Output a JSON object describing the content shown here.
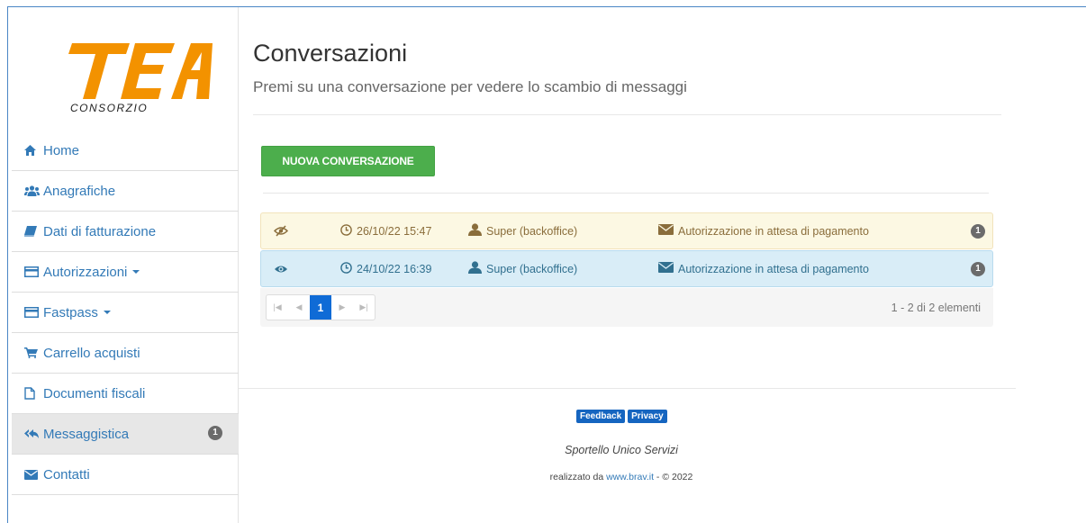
{
  "brand": {
    "logo_text": "TEA",
    "logo_sub": "CONSORZIO"
  },
  "sidebar": {
    "items": [
      {
        "label": "Home",
        "icon": "home-icon"
      },
      {
        "label": "Anagrafiche",
        "icon": "users-icon"
      },
      {
        "label": "Dati di fatturazione",
        "icon": "book-icon"
      },
      {
        "label": "Autorizzazioni",
        "icon": "card-icon",
        "dropdown": true
      },
      {
        "label": "Fastpass",
        "icon": "card-icon",
        "dropdown": true
      },
      {
        "label": "Carrello acquisti",
        "icon": "cart-icon"
      },
      {
        "label": "Documenti fiscali",
        "icon": "file-icon"
      },
      {
        "label": "Messaggistica",
        "icon": "reply-all-icon",
        "badge": "1",
        "active": true
      },
      {
        "label": "Contatti",
        "icon": "envelope-icon"
      }
    ]
  },
  "main": {
    "title": "Conversazioni",
    "subtitle": "Premi su una conversazione per vedere lo scambio di messaggi",
    "new_button": "NUOVA CONVERSAZIONE"
  },
  "conversations": [
    {
      "state": "unread",
      "icon": "eye-slash-icon",
      "date": "26/10/22 15:47",
      "user": "Super (backoffice)",
      "subject": "Autorizzazione in attesa di pagamento",
      "count": "1"
    },
    {
      "state": "read",
      "icon": "eye-icon",
      "date": "24/10/22 16:39",
      "user": "Super (backoffice)",
      "subject": "Autorizzazione in attesa di pagamento",
      "count": "1"
    }
  ],
  "pager": {
    "current": "1",
    "info": "1 - 2 di 2 elementi"
  },
  "footer": {
    "feedback": "Feedback",
    "privacy": "Privacy",
    "title": "Sportello Unico Servizi",
    "credit_prefix": "realizzato da ",
    "credit_link": "www.brav.it",
    "credit_suffix": " - © 2022"
  },
  "colors": {
    "accent": "#337ab7",
    "success": "#4cae4c",
    "warning_bg": "#fcf8e3",
    "info_bg": "#d9edf7",
    "logo_orange": "#f39200"
  }
}
